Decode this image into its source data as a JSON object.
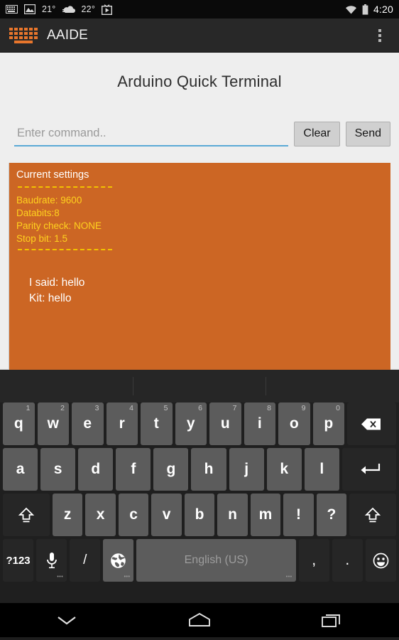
{
  "statusbar": {
    "icons": [
      "keyboard-notification-icon",
      "photo-icon",
      "cloud-icon",
      "play-store-icon"
    ],
    "temp1": "21°",
    "temp2": "22°",
    "wifi_icon": "wifi-icon",
    "battery_icon": "battery-icon",
    "time": "4:20"
  },
  "actionbar": {
    "app_icon": "keyboard-app-icon",
    "title": "AAIDE",
    "overflow_icon": "overflow-menu-icon"
  },
  "main": {
    "page_title": "Arduino Quick Terminal",
    "command_input": {
      "value": "",
      "placeholder": "Enter command.."
    },
    "clear_button": "Clear",
    "send_button": "Send"
  },
  "terminal": {
    "heading": "Current settings",
    "settings": [
      "Baudrate: 9600",
      "Databits:8",
      "Parity check: NONE",
      "Stop bit: 1.5"
    ],
    "messages": [
      "I said:  hello",
      "Kit: hello"
    ],
    "bg_color": "#cc6624",
    "settings_color": "#ffd21e",
    "rule_color": "#f2c200"
  },
  "keyboard": {
    "language": "English (US)",
    "row1": [
      {
        "label": "q",
        "num": "1"
      },
      {
        "label": "w",
        "num": "2"
      },
      {
        "label": "e",
        "num": "3"
      },
      {
        "label": "r",
        "num": "4"
      },
      {
        "label": "t",
        "num": "5"
      },
      {
        "label": "y",
        "num": "6"
      },
      {
        "label": "u",
        "num": "7"
      },
      {
        "label": "i",
        "num": "8"
      },
      {
        "label": "o",
        "num": "9"
      },
      {
        "label": "p",
        "num": "0"
      }
    ],
    "row2": [
      "a",
      "s",
      "d",
      "f",
      "g",
      "h",
      "j",
      "k",
      "l"
    ],
    "row3": [
      "z",
      "x",
      "c",
      "v",
      "b",
      "n",
      "m",
      "!",
      "?"
    ],
    "backspace_icon": "backspace-icon",
    "enter_icon": "enter-icon",
    "shift_icon": "shift-icon",
    "symbols_key": "?123",
    "mic_icon": "microphone-icon",
    "slash_key": "/",
    "globe_icon": "language-globe-icon",
    "comma_key": ",",
    "period_key": ".",
    "emoji_icon": "emoji-icon"
  },
  "navbar": {
    "back_icon": "hide-keyboard-chevron-icon",
    "home_icon": "home-icon",
    "recents_icon": "recent-apps-icon"
  }
}
